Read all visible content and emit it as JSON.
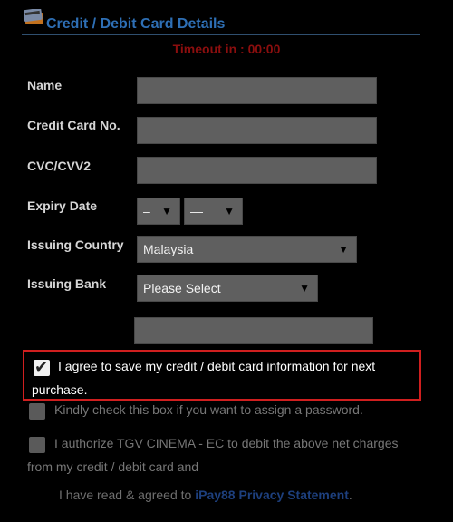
{
  "header": {
    "title": "Credit / Debit Card Details",
    "timeout": "Timeout in : 00:00"
  },
  "form": {
    "name_label": "Name",
    "card_number_label": "Credit Card No.",
    "cvc_label": "CVC/CVV2",
    "expiry_label": "Expiry Date",
    "expiry_month_value": "–",
    "expiry_year_value": "—",
    "country_label": "Issuing Country",
    "country_value": "Malaysia",
    "bank_label": "Issuing Bank",
    "bank_value": "Please Select",
    "name_value": "",
    "card_number_value": "",
    "cvc_value": "",
    "extra_value": ""
  },
  "checkboxes": {
    "save_card": {
      "text": "I agree to save my credit / debit card information for next purchase.",
      "checked": true
    },
    "assign_password": {
      "text": "Kindly check this box if you want to assign a password.",
      "checked": false
    },
    "authorize": {
      "text": "I authorize TGV CINEMA - EC to debit the above net charges from my credit / debit card and",
      "checked": false
    }
  },
  "policy": {
    "prefix": "I have read & agreed to ",
    "link": "iPay88 Privacy Statement",
    "suffix": "."
  },
  "colors": {
    "title": "#2e6fb5",
    "timeout": "#8b0e0e",
    "highlight_border": "#d01f1f",
    "link": "#1d3f7d"
  }
}
